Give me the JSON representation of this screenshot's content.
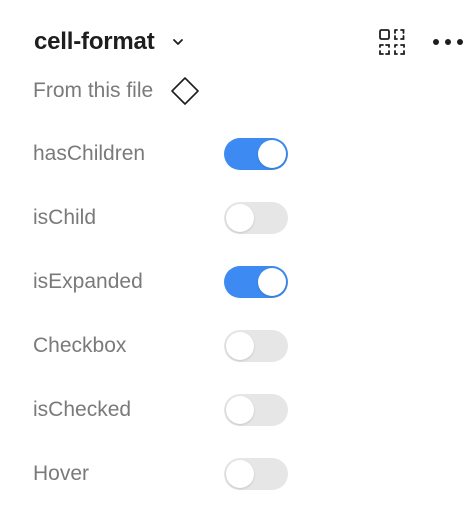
{
  "header": {
    "title": "cell-format",
    "dropdown_icon": "chevron-down-icon",
    "instance_icon": "instance-icon",
    "more_icon": "more-horizontal-icon"
  },
  "source": {
    "label": "From this file",
    "icon": "component-diamond-icon"
  },
  "properties": [
    {
      "label": "hasChildren",
      "on": true
    },
    {
      "label": "isChild",
      "on": false
    },
    {
      "label": "isExpanded",
      "on": true
    },
    {
      "label": "Checkbox",
      "on": false
    },
    {
      "label": "isChecked",
      "on": false
    },
    {
      "label": "Hover",
      "on": false
    }
  ],
  "colors": {
    "toggle_on": "#3d8bf2",
    "toggle_off": "#e6e6e6",
    "label": "#7a7a7a",
    "title": "#1e1e1e"
  }
}
